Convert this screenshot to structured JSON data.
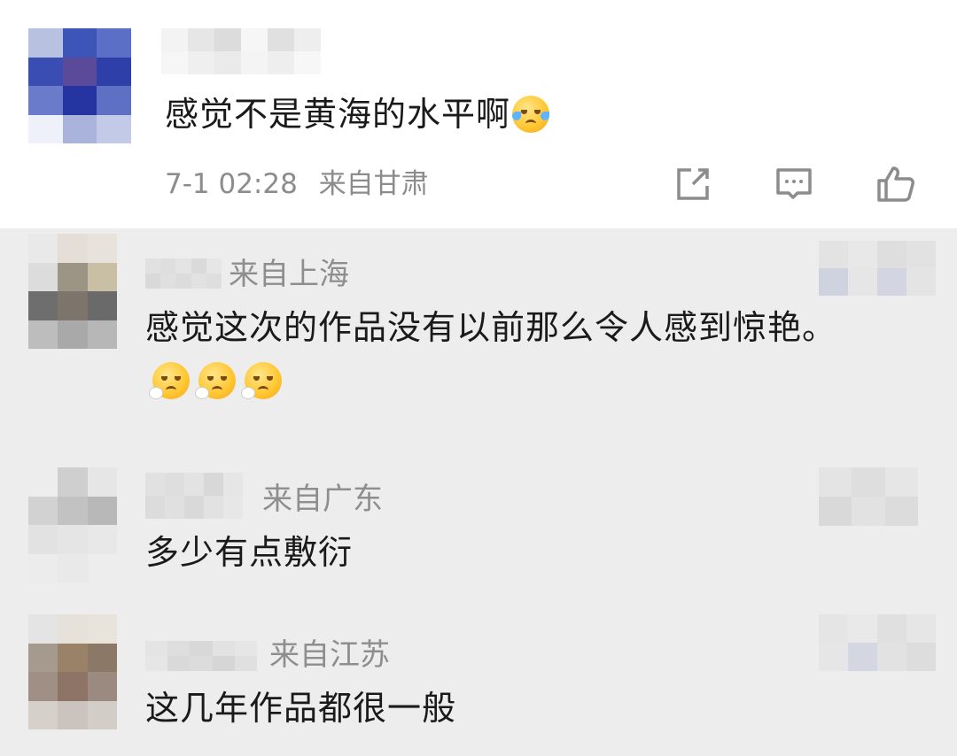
{
  "main_comment": {
    "text": "感觉不是黄海的水平啊",
    "emoji": "laughing-crying-emoji",
    "time": "7-1 02:28",
    "location": "来自甘肃",
    "actions": [
      "share-icon",
      "comment-icon",
      "like-icon"
    ]
  },
  "replies": [
    {
      "location": "来自上海",
      "text": "感觉这次的作品没有以前那么令人感到惊艳。",
      "emojis": [
        "face-exhaling-emoji",
        "face-exhaling-emoji",
        "face-exhaling-emoji"
      ]
    },
    {
      "location": "来自广东",
      "text": "多少有点敷衍"
    },
    {
      "location": "来自江苏",
      "text": "这几年作品都很一般"
    }
  ],
  "colors": {
    "background_top": "#ffffff",
    "background_replies": "#ededed",
    "meta_text": "#8c8c8c"
  }
}
